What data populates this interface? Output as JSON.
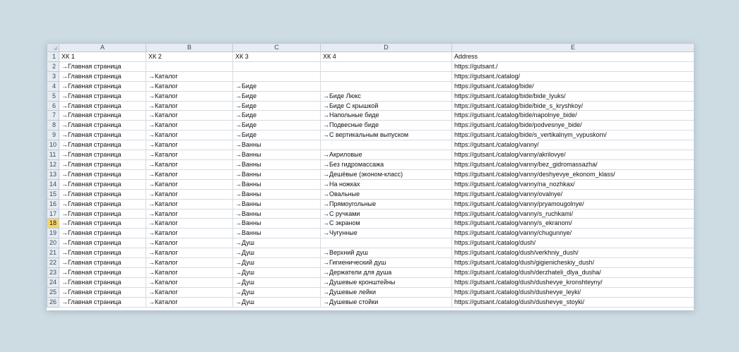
{
  "sheet": {
    "corner": "",
    "columns": [
      "A",
      "B",
      "C",
      "D",
      "E"
    ],
    "active_row": 18,
    "rows": [
      {
        "n": "1",
        "cells": [
          "ХК 1",
          "ХК 2",
          "ХК 3",
          "ХК 4",
          "Address"
        ]
      },
      {
        "n": "2",
        "cells": [
          "→Главная страница",
          "",
          "",
          "",
          "https://gutsant./"
        ]
      },
      {
        "n": "3",
        "cells": [
          "→Главная страница",
          "→Каталог",
          "",
          "",
          "https://gutsant./catalog/"
        ]
      },
      {
        "n": "4",
        "cells": [
          "→Главная страница",
          "→Каталог",
          "→Биде",
          "",
          "https://gutsant./catalog/bide/"
        ]
      },
      {
        "n": "5",
        "cells": [
          "→Главная страница",
          "→Каталог",
          "→Биде",
          "→Биде Люкс",
          "https://gutsant./catalog/bide/bide_lyuks/"
        ]
      },
      {
        "n": "6",
        "cells": [
          "→Главная страница",
          "→Каталог",
          "→Биде",
          "→Биде С крышкой",
          "https://gutsant./catalog/bide/bide_s_kryshkoy/"
        ]
      },
      {
        "n": "7",
        "cells": [
          "→Главная страница",
          "→Каталог",
          "→Биде",
          "→Напольные биде",
          "https://gutsant./catalog/bide/napolnye_bide/"
        ]
      },
      {
        "n": "8",
        "cells": [
          "→Главная страница",
          "→Каталог",
          "→Биде",
          "→Подвесные биде",
          "https://gutsant./catalog/bide/podvesnye_bide/"
        ]
      },
      {
        "n": "9",
        "cells": [
          "→Главная страница",
          "→Каталог",
          "→Биде",
          "→С вертикальным выпуском",
          "https://gutsant./catalog/bide/s_vertikalnym_vypuskom/"
        ]
      },
      {
        "n": "10",
        "cells": [
          "→Главная страница",
          "→Каталог",
          "→Ванны",
          "",
          "https://gutsant./catalog/vanny/"
        ]
      },
      {
        "n": "11",
        "cells": [
          "→Главная страница",
          "→Каталог",
          "→Ванны",
          "→Акриловые",
          "https://gutsant./catalog/vanny/akrilovye/"
        ]
      },
      {
        "n": "12",
        "cells": [
          "→Главная страница",
          "→Каталог",
          "→Ванны",
          "→Без гидромассажа",
          "https://gutsant./catalog/vanny/bez_gidromassazha/"
        ]
      },
      {
        "n": "13",
        "cells": [
          "→Главная страница",
          "→Каталог",
          "→Ванны",
          "→Дешёвые (эконом-класс)",
          "https://gutsant./catalog/vanny/deshyevye_ekonom_klass/"
        ]
      },
      {
        "n": "14",
        "cells": [
          "→Главная страница",
          "→Каталог",
          "→Ванны",
          "→На ножках",
          "https://gutsant./catalog/vanny/na_nozhkax/"
        ]
      },
      {
        "n": "15",
        "cells": [
          "→Главная страница",
          "→Каталог",
          "→Ванны",
          "→Овальные",
          "https://gutsant./catalog/vanny/ovalnye/"
        ]
      },
      {
        "n": "16",
        "cells": [
          "→Главная страница",
          "→Каталог",
          "→Ванны",
          "→Прямоугольные",
          "https://gutsant./catalog/vanny/pryamougolnye/"
        ]
      },
      {
        "n": "17",
        "cells": [
          "→Главная страница",
          "→Каталог",
          "→Ванны",
          "→С ручками",
          "https://gutsant./catalog/vanny/s_ruchkami/"
        ]
      },
      {
        "n": "18",
        "cells": [
          "→Главная страница",
          "→Каталог",
          "→Ванны",
          "→С экраном",
          "https://gutsant./catalog/vanny/s_ekranom/"
        ]
      },
      {
        "n": "19",
        "cells": [
          "→Главная страница",
          "→Каталог",
          "→Ванны",
          "→Чугунные",
          "https://gutsant./catalog/vanny/chugunnye/"
        ]
      },
      {
        "n": "20",
        "cells": [
          "→Главная страница",
          "→Каталог",
          "→Душ",
          "",
          "https://gutsant./catalog/dush/"
        ]
      },
      {
        "n": "21",
        "cells": [
          "→Главная страница",
          "→Каталог",
          "→Душ",
          "→Верхний душ",
          "https://gutsant./catalog/dush/verkhniy_dush/"
        ]
      },
      {
        "n": "22",
        "cells": [
          "→Главная страница",
          "→Каталог",
          "→Душ",
          "→Гигиенический душ",
          "https://gutsant./catalog/dush/gigienicheskiy_dush/"
        ]
      },
      {
        "n": "23",
        "cells": [
          "→Главная страница",
          "→Каталог",
          "→Душ",
          "→Держатели для душа",
          "https://gutsant./catalog/dush/derzhateli_dlya_dusha/"
        ]
      },
      {
        "n": "24",
        "cells": [
          "→Главная страница",
          "→Каталог",
          "→Душ",
          "→Душевые кронштейны",
          "https://gutsant./catalog/dush/dushevye_kronshteyny/"
        ]
      },
      {
        "n": "25",
        "cells": [
          "→Главная страница",
          "→Каталог",
          "→Душ",
          "→Душевые лейки",
          "https://gutsant./catalog/dush/dushevye_leyki/"
        ]
      },
      {
        "n": "26",
        "cells": [
          "→Главная страница",
          "→Каталог",
          "→Душ",
          "→Душевые стойки",
          "https://gutsant./catalog/dush/dushevye_stoyki/"
        ]
      }
    ]
  }
}
